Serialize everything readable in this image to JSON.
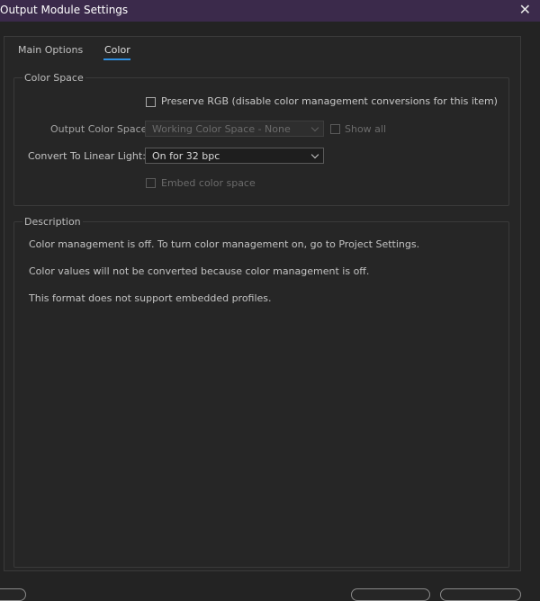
{
  "window": {
    "title": "Output Module Settings",
    "close_icon": "close-icon"
  },
  "tabs": [
    {
      "label": "Main Options",
      "active": false
    },
    {
      "label": "Color",
      "active": true
    }
  ],
  "color_space": {
    "group_title": "Color Space",
    "preserve_rgb_label": "Preserve RGB (disable color management conversions for this item)",
    "preserve_rgb_checked": false,
    "output_color_space_label": "Output Color Space:",
    "output_color_space_value": "Working Color Space - None",
    "show_all_label": "Show all",
    "show_all_checked": false,
    "convert_linear_label": "Convert To Linear Light:",
    "convert_linear_value": "On for 32 bpc",
    "embed_label": "Embed color space",
    "embed_checked": false
  },
  "description": {
    "group_title": "Description",
    "lines": [
      "Color management is off. To turn color management on, go to Project Settings.",
      "Color values will not be converted because color management is off.",
      "This format does not support embedded profiles."
    ]
  },
  "colors": {
    "titlebar": "#3b2a4b",
    "accent": "#2f8fe0",
    "background": "#232323"
  }
}
